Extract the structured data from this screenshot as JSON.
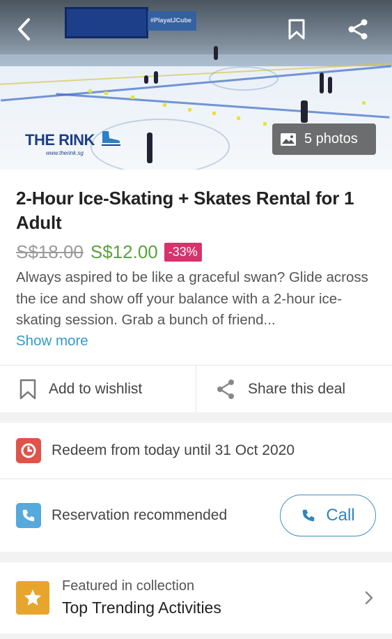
{
  "hero": {
    "photos_label": "5 photos",
    "logo_text": "THE RINK",
    "logo_url": "www.therink.sg",
    "board_text": "#PlayatJCube"
  },
  "deal": {
    "title": "2-Hour Ice-Skating + Skates Rental for 1 Adult",
    "old_price": "S$18.00",
    "new_price": "S$12.00",
    "discount": "-33%",
    "description": "Always aspired to be like a graceful swan? Glide across the ice and show off your balance with a 2-hour ice-skating session. Grab a bunch of friend...",
    "show_more": "Show more"
  },
  "actions": {
    "wishlist_label": "Add to wishlist",
    "share_label": "Share this deal"
  },
  "info": {
    "redeem_text": "Redeem from today until 31 Oct 2020",
    "reservation_text": "Reservation recommended",
    "call_label": "Call"
  },
  "collection": {
    "subtitle": "Featured in collection",
    "title": "Top Trending Activities"
  },
  "colors": {
    "new_price": "#5aa23b",
    "discount_badge": "#d6336c",
    "link": "#3399cc",
    "redeem_icon": "#e0534a",
    "reservation_icon": "#55a9dc",
    "collection_icon": "#e8a52e"
  }
}
